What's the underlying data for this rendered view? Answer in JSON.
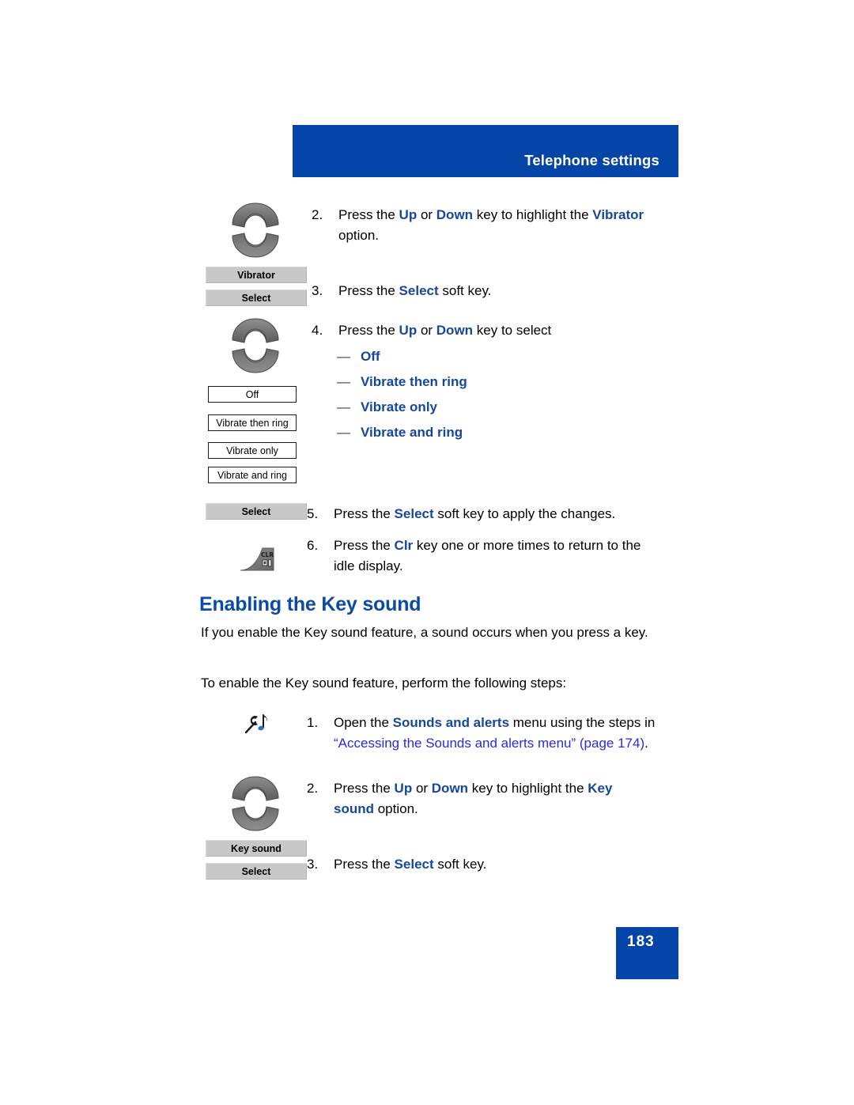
{
  "header": {
    "title": "Telephone settings"
  },
  "page_badge": {
    "number": "183"
  },
  "vibrator_procedure": {
    "step2": {
      "number": "2.",
      "t1": "Press the ",
      "b1": "Up",
      "t2": " or ",
      "b2": "Down",
      "t3": " key to highlight the ",
      "b3": "Vibrator",
      "t4": " option."
    },
    "step3": {
      "number": "3.",
      "t1": "Press the ",
      "b1": "Select",
      "t2": " soft key."
    },
    "step4": {
      "number": "4.",
      "t1": "Press the ",
      "b1": "Up",
      "t2": " or ",
      "b2": "Down",
      "t3": " key to select"
    },
    "step5": {
      "number": "5.",
      "t1": "Press the ",
      "b1": "Select",
      "t2": " soft key to apply the changes."
    },
    "step6": {
      "number": "6.",
      "t1": "Press the ",
      "b1": "Clr",
      "t2": " key one or more times to return to the idle display."
    },
    "options": [
      {
        "dash": "—",
        "label": "Off"
      },
      {
        "dash": "—",
        "label": "Vibrate then ring"
      },
      {
        "dash": "—",
        "label": "Vibrate only"
      },
      {
        "dash": "—",
        "label": "Vibrate and ring"
      }
    ],
    "callouts": {
      "vibrator_button": "Vibrator",
      "select_button_1": "Select",
      "select_button_2": "Select",
      "optbox_off": "Off",
      "optbox_vibrate_then_ring": "Vibrate then ring",
      "optbox_vibrate_only": "Vibrate only",
      "optbox_vibrate_and_ring": "Vibrate and ring",
      "clr_key_label": "CLR"
    }
  },
  "key_sound_section": {
    "heading": "Enabling the Key sound",
    "intro": "If you enable the Key sound feature, a sound occurs when you press a key.",
    "lead_in": "To enable the Key sound feature, perform the following steps:",
    "step1": {
      "number": "1.",
      "t1": "Open the ",
      "b1": "Sounds and alerts",
      "t2": " menu using the steps in ",
      "x1": "“Accessing the Sounds and alerts menu” (page 174)",
      "t3": "."
    },
    "step2": {
      "number": "2.",
      "t1": "Press the ",
      "b1": "Up",
      "t2": " or ",
      "b2": "Down",
      "t3": " key to highlight the ",
      "b3": "Key sound",
      "t4": " option."
    },
    "step3": {
      "number": "3.",
      "t1": "Press the ",
      "b1": "Select",
      "t2": " soft key."
    },
    "callouts": {
      "key_sound_button": "Key sound",
      "select_button": "Select"
    }
  },
  "colors": {
    "brand_blue": "#0545a8",
    "heading_blue": "#0b4ba6",
    "bold_blue": "#16479e",
    "xref_blue": "#2a2ae0",
    "softkey_gray": "#c8c8c8"
  }
}
